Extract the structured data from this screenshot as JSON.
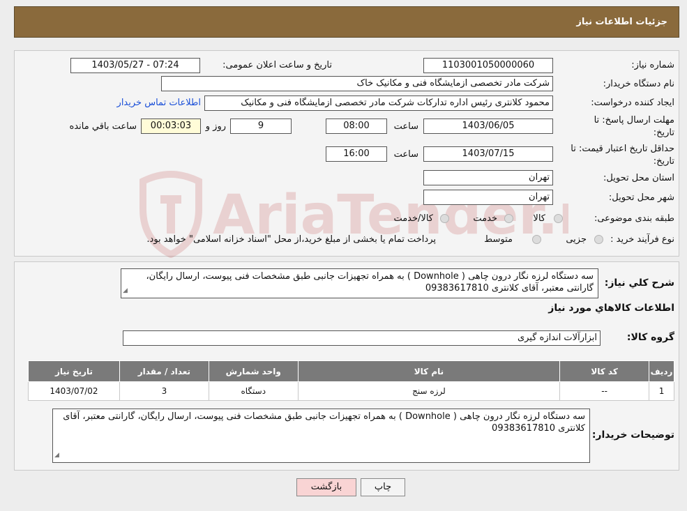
{
  "header": {
    "title": "جزئیات اطلاعات نیاز"
  },
  "fields": {
    "need_number_label": "شماره نیاز:",
    "need_number": "1103001050000060",
    "announce_label": "تاریخ و ساعت اعلان عمومی:",
    "announce_value": "1403/05/27 - 07:24",
    "buyer_org_label": "نام دستگاه خریدار:",
    "buyer_org": "شرکت مادر تخصصی ازمایشگاه فنی و مکانیک خاک",
    "creator_label": "ایجاد کننده درخواست:",
    "creator": "محمود کلانتری رئیس اداره تدارکات شرکت مادر تخصصی ازمایشگاه فنی و مکانیک",
    "contact_link": "اطلاعات تماس خریدار",
    "deadline_label_1": "مهلت ارسال پاسخ: تا",
    "deadline_label_2": "تاریخ:",
    "deadline_date": "1403/06/05",
    "time_label": "ساعت",
    "deadline_time": "08:00",
    "days_value": "9",
    "days_label": "روز و",
    "remaining_value": "00:03:03",
    "remaining_label": "ساعت باقي مانده",
    "validity_label_1": "حداقل تاریخ اعتبار قیمت: تا",
    "validity_label_2": "تاریخ:",
    "validity_date": "1403/07/15",
    "validity_time": "16:00",
    "province_label": "استان محل تحویل:",
    "province": "تهران",
    "city_label": "شهر محل تحویل:",
    "city": "تهران",
    "category_label": "طبقه بندی موضوعی:",
    "category_options": [
      "کالا",
      "خدمت",
      "کالا/خدمت"
    ],
    "process_label": "نوع فرآیند خرید :",
    "process_options": [
      "جزیی",
      "متوسط"
    ],
    "process_note": "پرداخت تمام یا بخشی از مبلغ خرید،از محل \"اسناد خزانه اسلامی\" خواهد بود."
  },
  "description": {
    "label": "شرح کلي نياز:",
    "text": "سه دستگاه لرزه نگار درون چاهی ( Downhole ) به همراه تجهیزات جانبی طبق مشخصات فنی پیوست، ارسال رایگان، گارانتی معتبر، آقای کلانتری 09383617810"
  },
  "goods": {
    "section_title": "اطلاعات کالاهاي مورد نياز",
    "group_label": "گروه کالا:",
    "group_value": "ابزارآلات اندازه گیری",
    "columns": [
      "ردیف",
      "کد کالا",
      "نام کالا",
      "واحد شمارش",
      "تعداد / مقدار",
      "تاریخ نیاز"
    ],
    "rows": [
      [
        "1",
        "--",
        "لرزه سنج",
        "دستگاه",
        "3",
        "1403/07/02"
      ]
    ]
  },
  "buyer_notes": {
    "label": "توضیحات خریدار:",
    "text": "سه دستگاه لرزه نگار درون چاهی ( Downhole ) به همراه تجهیزات جانبی طبق مشخصات فنی پیوست، ارسال رایگان، گارانتی معتبر، آقای کلانتری 09383617810"
  },
  "buttons": {
    "print": "چاپ",
    "back": "بازگشت"
  },
  "watermark": {
    "text": "AriaTender.neT"
  },
  "colors": {
    "header": "#8a6a3c",
    "link": "#1a4fd8",
    "back_button": "#f9d4d4",
    "remaining_bg": "#fffcd8"
  }
}
